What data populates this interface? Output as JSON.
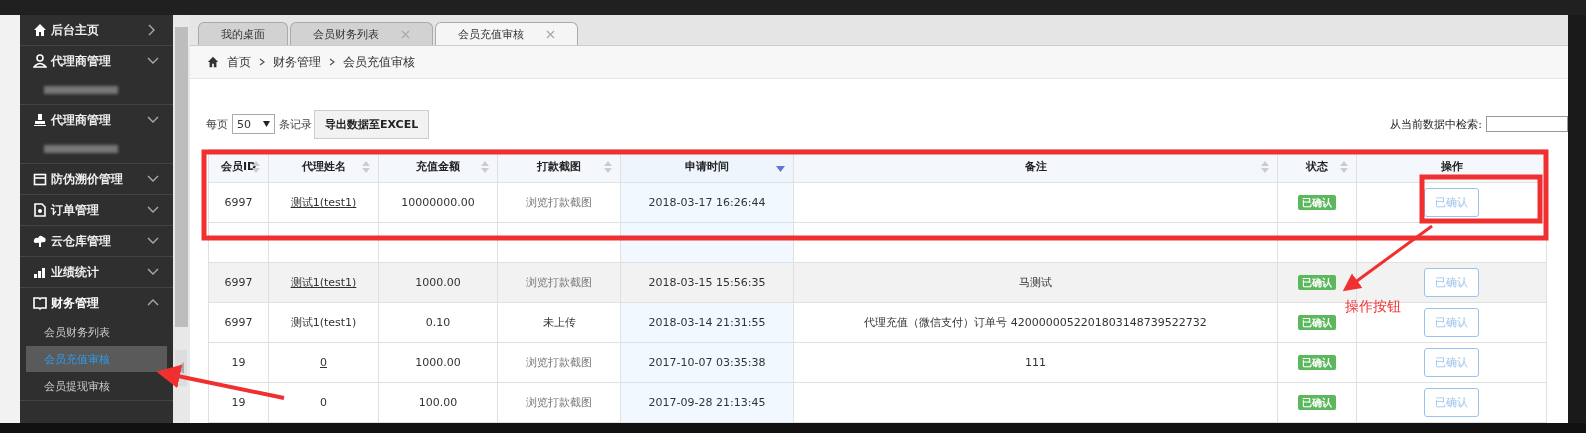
{
  "sidebar": {
    "items": [
      {
        "label": "后台主页",
        "kind": "link"
      },
      {
        "label": "代理商管理",
        "kind": "group",
        "expanded": false,
        "children": [
          {
            "kind": "redacted",
            "selected": false
          }
        ]
      },
      {
        "label": "代理商管理",
        "kind": "group",
        "expanded": false,
        "children": [
          {
            "kind": "redacted",
            "selected": false
          }
        ]
      },
      {
        "label": "防伪溯价管理",
        "kind": "group",
        "expanded": false
      },
      {
        "label": "订单管理",
        "kind": "group",
        "expanded": false
      },
      {
        "label": "云仓库管理",
        "kind": "group",
        "expanded": false
      },
      {
        "label": "业绩统计",
        "kind": "group",
        "expanded": false
      },
      {
        "label": "财务管理",
        "kind": "group",
        "expanded": true,
        "children": [
          {
            "label": "会员财务列表",
            "kind": "link",
            "selected": false
          },
          {
            "label": "会员充值审核",
            "kind": "link",
            "selected": true
          },
          {
            "label": "会员提现审核",
            "kind": "link",
            "selected": false
          }
        ]
      }
    ]
  },
  "tabs": [
    {
      "label": "我的桌面",
      "closable": false,
      "selected": false
    },
    {
      "label": "会员财务列表",
      "closable": true,
      "selected": false
    },
    {
      "label": "会员充值审核",
      "closable": true,
      "selected": true
    }
  ],
  "breadcrumb": [
    "首页",
    "财务管理",
    "会员充值审核"
  ],
  "toolbar": {
    "per_page_label": "每页",
    "per_page": "50",
    "records_label": "条记录",
    "export_button": "导出数据至EXCEL",
    "search_label": "从当前数据中检索:"
  },
  "table": {
    "columns": [
      {
        "label": "会员ID",
        "sortable": true,
        "sorted_desc": false
      },
      {
        "label": "代理姓名",
        "sortable": true,
        "sorted_desc": false
      },
      {
        "label": "充值金额",
        "sortable": true,
        "sorted_desc": false
      },
      {
        "label": "打款截图",
        "sortable": true,
        "sorted_desc": false
      },
      {
        "label": "申请时间",
        "sortable": true,
        "sorted_desc": true
      },
      {
        "label": "备注",
        "sortable": true,
        "sorted_desc": false
      },
      {
        "label": "状态",
        "sortable": true,
        "sorted_desc": false
      },
      {
        "label": "操作",
        "sortable": false,
        "sorted_desc": false
      }
    ],
    "rows": [
      {
        "kind": "record",
        "id": "6997",
        "name": "测试1(test1)",
        "name_linked": true,
        "amount": "10000000.00",
        "screenshot": "浏览打款截图",
        "uploaded": true,
        "time": "2018-03-17 16:26:44",
        "status": "已确认",
        "action": "已确认",
        "selected": false
      },
      {
        "kind": "covered",
        "selected": false
      },
      {
        "kind": "record",
        "id": "6997",
        "name": "测试1(test1)",
        "name_linked": true,
        "amount": "1000.00",
        "screenshot": "浏览打款截图",
        "uploaded": true,
        "time": "2018-03-15 15:56:35",
        "remark": "马测试",
        "status": "已确认",
        "action": "已确认",
        "selected": true
      },
      {
        "kind": "record",
        "id": "6997",
        "name": "测试1(test1)",
        "name_linked": false,
        "amount": "0.10",
        "screenshot": "未上传",
        "uploaded": false,
        "time": "2018-03-14 21:31:55",
        "remark": "代理充值（微信支付）订单号 4200000052201803148739522732",
        "status": "已确认",
        "action": "已确认",
        "selected": false
      },
      {
        "kind": "record",
        "id": "19",
        "name": "0",
        "name_linked": true,
        "amount": "1000.00",
        "screenshot": "浏览打款截图",
        "uploaded": true,
        "time": "2017-10-07 03:35:38",
        "remark": "111",
        "status": "已确认",
        "action": "已确认",
        "selected": false
      },
      {
        "kind": "record",
        "id": "19",
        "name": "0",
        "name_linked": false,
        "amount": "100.00",
        "screenshot": "浏览打款截图",
        "uploaded": true,
        "time": "2017-09-28 21:13:45",
        "status": "已确认",
        "action": "已确认",
        "selected": false
      }
    ]
  },
  "annotation": {
    "label": "操作按钮"
  }
}
